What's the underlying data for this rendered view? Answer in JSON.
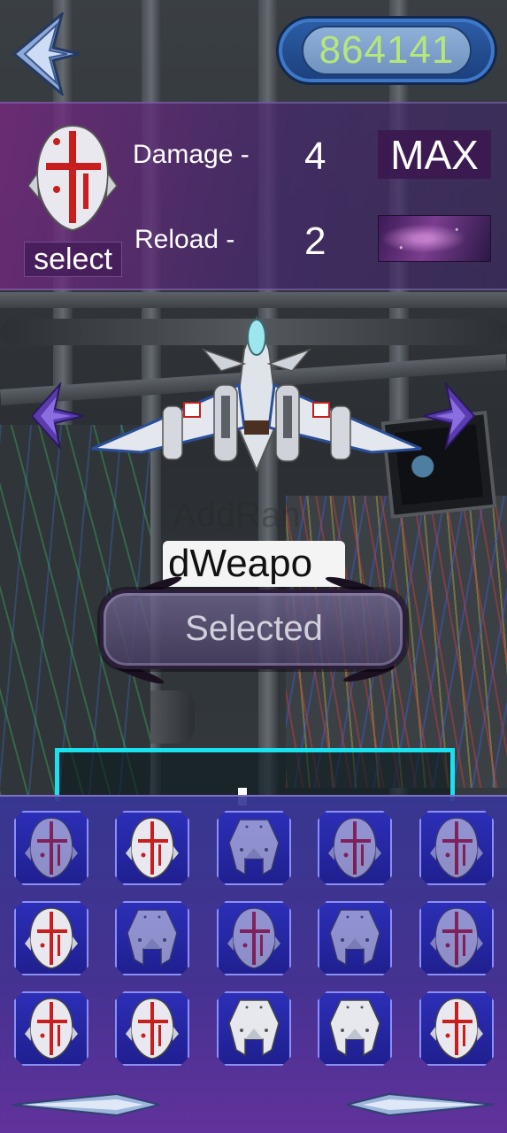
{
  "score": {
    "value": "864141"
  },
  "stats": {
    "damage_label": "Damage -",
    "damage_value": "4",
    "reload_label": "Reload -",
    "reload_value": "2",
    "max_label": "MAX",
    "select_label": "select"
  },
  "name_field": {
    "value": "dWeapo"
  },
  "selected_button": {
    "label": "Selected"
  },
  "inventory": {
    "rows": [
      [
        {
          "icon": "shield-weapon-icon",
          "state": "dim"
        },
        {
          "icon": "shield-weapon-icon",
          "state": "bright"
        },
        {
          "icon": "wing-weapon-icon",
          "state": "dim"
        },
        {
          "icon": "shield-weapon-icon",
          "state": "dim"
        },
        {
          "icon": "shield-weapon-icon",
          "state": "dim"
        }
      ],
      [
        {
          "icon": "shield-weapon-icon",
          "state": "bright"
        },
        {
          "icon": "wing-weapon-icon",
          "state": "dim"
        },
        {
          "icon": "shield-weapon-icon",
          "state": "dim"
        },
        {
          "icon": "wing-weapon-icon",
          "state": "dim"
        },
        {
          "icon": "shield-weapon-icon",
          "state": "dim"
        }
      ],
      [
        {
          "icon": "shield-weapon-icon",
          "state": "bright"
        },
        {
          "icon": "shield-weapon-icon",
          "state": "bright"
        },
        {
          "icon": "wing-weapon-icon",
          "state": "bright"
        },
        {
          "icon": "wing-weapon-icon",
          "state": "bright"
        },
        {
          "icon": "shield-weapon-icon",
          "state": "bright"
        }
      ]
    ]
  },
  "colors": {
    "score_text": "#b6e77a",
    "slot_frame": "#8b8ff5",
    "cyan_frame": "#19e1ee",
    "weapon_red": "#c81e1e"
  }
}
